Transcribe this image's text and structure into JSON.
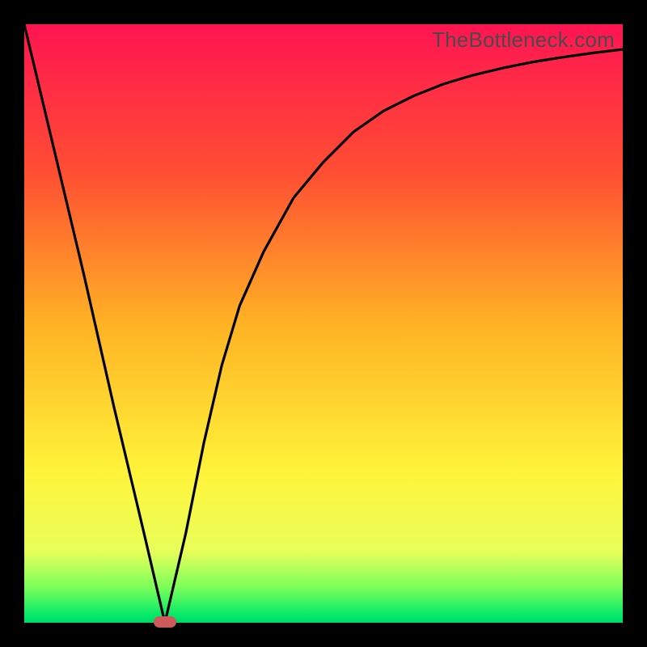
{
  "watermark": "TheBottleneck.com",
  "chart_data": {
    "type": "line",
    "title": "",
    "xlabel": "",
    "ylabel": "",
    "xlim": [
      0,
      100
    ],
    "ylim": [
      0,
      100
    ],
    "series": [
      {
        "name": "curve",
        "x": [
          0,
          5,
          10,
          15,
          20,
          23.5,
          27,
          30,
          33,
          36,
          40,
          45,
          50,
          55,
          60,
          65,
          70,
          75,
          80,
          85,
          90,
          95,
          100
        ],
        "values": [
          100,
          79,
          58,
          36,
          15,
          0,
          15,
          30,
          43,
          53,
          62,
          71,
          77,
          82,
          85.5,
          88,
          90,
          91.5,
          92.7,
          93.7,
          94.5,
          95.2,
          95.8
        ]
      }
    ],
    "marker": {
      "x": 23.5,
      "y": 0
    },
    "gradient_stops": [
      {
        "pos": 0,
        "color": "#ff1452"
      },
      {
        "pos": 25,
        "color": "#ff4f32"
      },
      {
        "pos": 50,
        "color": "#ffb224"
      },
      {
        "pos": 75,
        "color": "#fff43a"
      },
      {
        "pos": 88,
        "color": "#e9ff5a"
      },
      {
        "pos": 94,
        "color": "#7dff5a"
      },
      {
        "pos": 99,
        "color": "#00e86a"
      },
      {
        "pos": 100,
        "color": "#00d66a"
      }
    ]
  }
}
